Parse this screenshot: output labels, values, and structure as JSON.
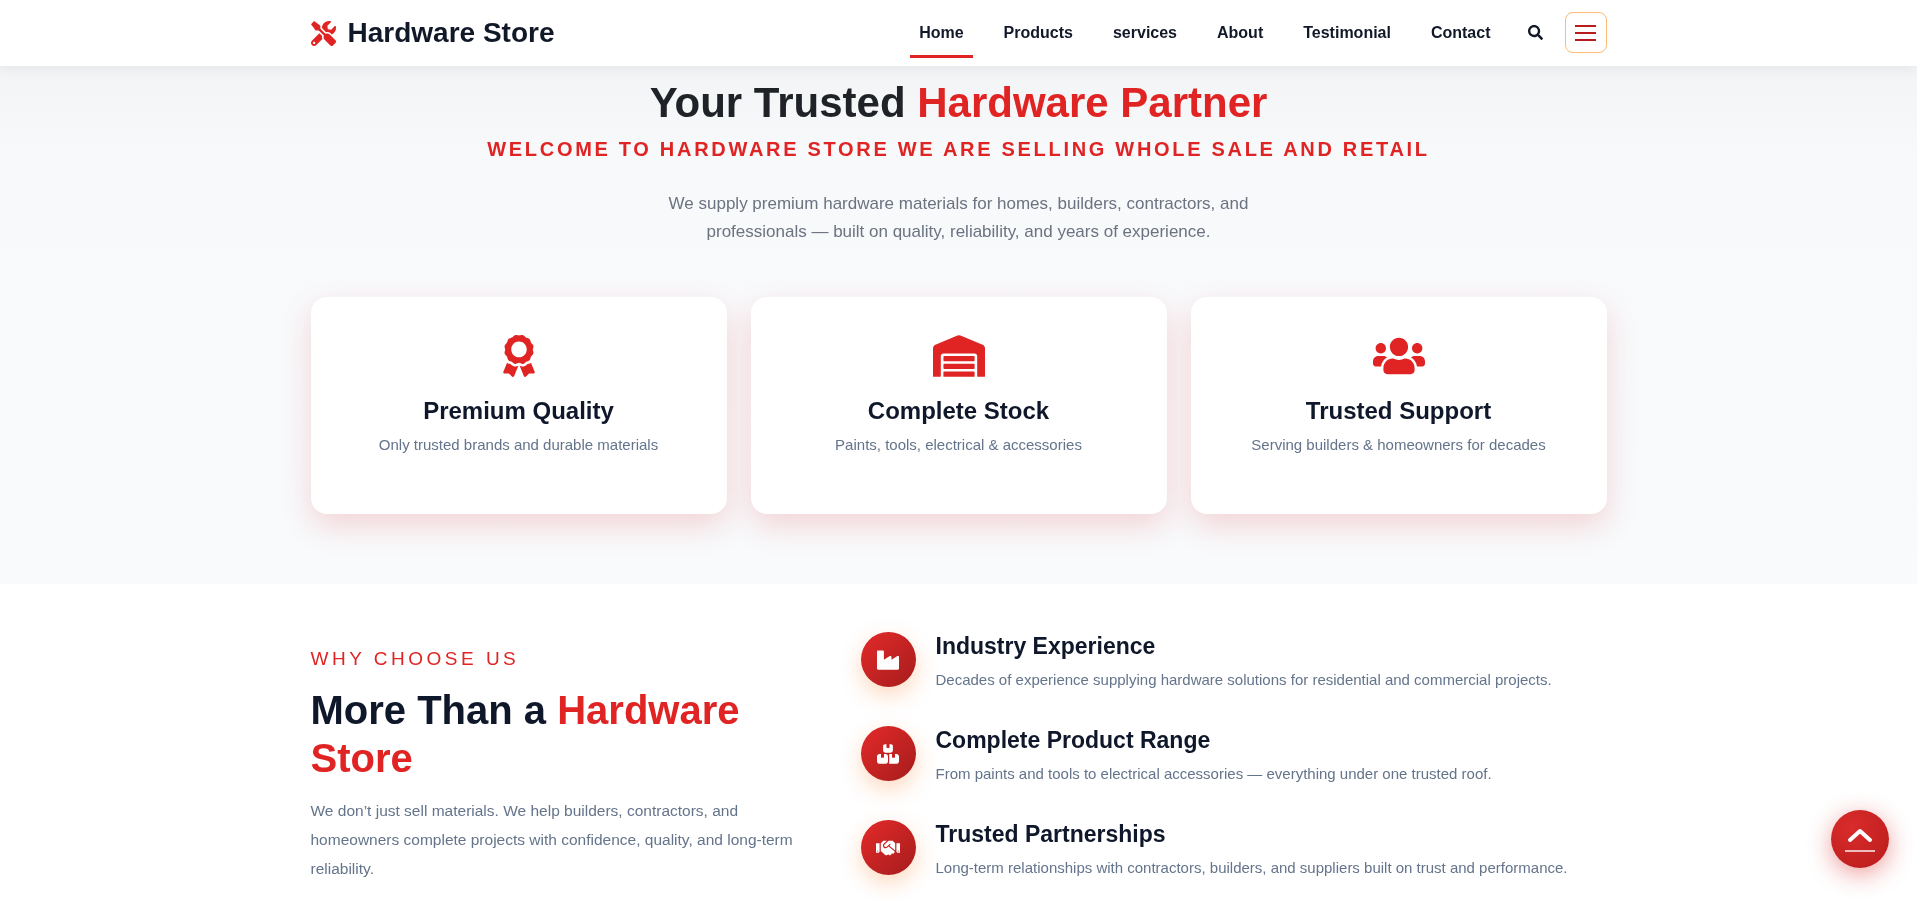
{
  "header": {
    "brand": "Hardware Store",
    "nav": [
      {
        "label": "Home",
        "selected": true
      },
      {
        "label": "Products",
        "selected": false
      },
      {
        "label": "services",
        "selected": false
      },
      {
        "label": "About",
        "selected": false
      },
      {
        "label": "Testimonial",
        "selected": false
      },
      {
        "label": "Contact",
        "selected": false
      }
    ]
  },
  "hero": {
    "title": {
      "lead": "Your Trusted",
      "highlight": "Hardware Partner"
    },
    "subtitle": "WELCOME TO HARDWARE STORE WE ARE SELLING WHOLE SALE AND RETAIL",
    "text": "We supply premium hardware materials for homes, builders, contractors, and professionals — built on quality, reliability, and years of experience.",
    "cards": [
      {
        "title": "Premium Quality",
        "text": "Only trusted brands and durable materials"
      },
      {
        "title": "Complete Stock",
        "text": "Paints, tools, electrical & accessories"
      },
      {
        "title": "Trusted Support",
        "text": "Serving builders & homeowners for decades"
      }
    ]
  },
  "why": {
    "eyebrow": "WHY CHOOSE US",
    "heading": {
      "lead": "More Than a",
      "highlight": "Hardware Store"
    },
    "text": "We don’t just sell materials. We help builders, contractors, and homeowners complete projects with confidence, quality, and long-term reliability.",
    "features": [
      {
        "title": "Industry Experience",
        "text": "Decades of experience supplying hardware solutions for residential and commercial projects."
      },
      {
        "title": "Complete Product Range",
        "text": "From paints and tools to electrical accessories — everything under one trusted roof."
      },
      {
        "title": "Trusted Partnerships",
        "text": "Long-term relationships with contractors, builders, and suppliers built on trust and performance."
      }
    ]
  }
}
